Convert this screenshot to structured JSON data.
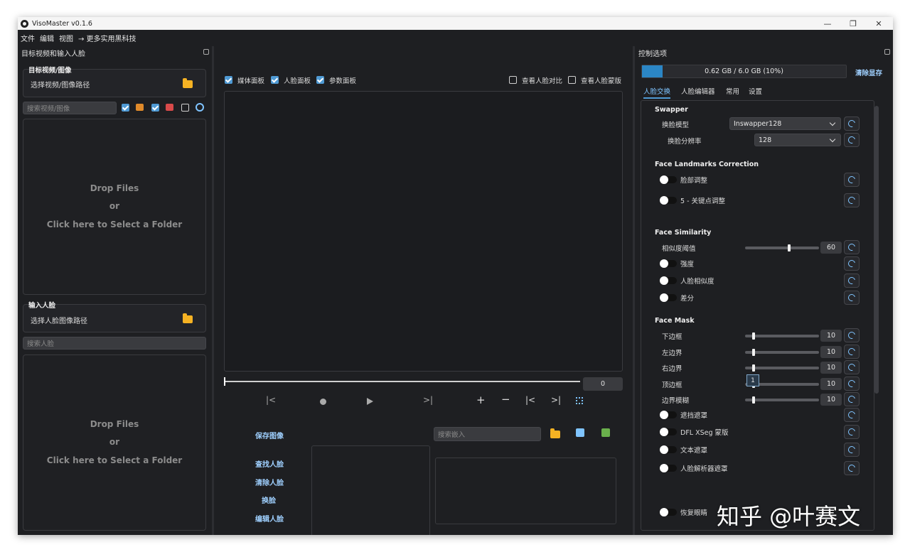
{
  "window": {
    "title": "VisoMaster v0.1.6"
  },
  "menu": [
    "文件",
    "编辑",
    "视图",
    "→ 更多实用黑科技"
  ],
  "left": {
    "dock_title": "目标视频和输入人脸",
    "target_group_title": "目标视频/图像",
    "target_path_label": "选择视频/图像路径",
    "search_media_placeholder": "搜索视频/图像",
    "drop": [
      "Drop Files",
      "or",
      "Click here to Select a Folder"
    ],
    "input_group_title": "输入人脸",
    "input_path_label": "选择人脸图像路径",
    "search_face_placeholder": "搜索人脸",
    "filters": [
      {
        "checked": true
      },
      {
        "checked": true
      },
      {
        "checked": false
      }
    ]
  },
  "center": {
    "checks": [
      {
        "label": "媒体面板",
        "checked": true
      },
      {
        "label": "人脸面板",
        "checked": true
      },
      {
        "label": "参数面板",
        "checked": true
      },
      {
        "label": "查看人脸对比",
        "checked": false
      },
      {
        "label": "查看人脸蒙版",
        "checked": false
      }
    ],
    "frame_value": "0",
    "save_image": "保存图像",
    "search_embed_placeholder": "搜索嵌入",
    "actions": [
      "查找人脸",
      "清除人脸",
      "换脸",
      "编辑人脸"
    ]
  },
  "right": {
    "dock_title": "控制选项",
    "vram_text": "0.62 GB / 6.0 GB (10%)",
    "vram_fraction": 0.1,
    "clear_vram": "清除显存",
    "tabs": [
      "人脸交换",
      "人脸编辑器",
      "常用",
      "设置"
    ],
    "sections": {
      "swapper": "Swapper",
      "landmarks": "Face Landmarks Correction",
      "similarity": "Face Similarity",
      "mask": "Face Mask"
    },
    "swap_model_label": "换脸模型",
    "swap_model_value": "Inswapper128",
    "swap_res_label": "换脸分辨率",
    "swap_res_value": "128",
    "landmark_toggles": [
      "脸部调整",
      "5 - 关键点调整"
    ],
    "sim_threshold_label": "相似度阈值",
    "sim_threshold_value": "60",
    "sim_toggles": [
      "强度",
      "人脸相似度",
      "差分"
    ],
    "mask_sliders": [
      {
        "label": "下边框",
        "value": "10"
      },
      {
        "label": "左边界",
        "value": "10"
      },
      {
        "label": "右边界",
        "value": "10"
      },
      {
        "label": "顶边框",
        "value": "10"
      },
      {
        "label": "边界模糊",
        "value": "10"
      }
    ],
    "tooltip_value": "1",
    "mask_toggles": [
      "遮挡遮罩",
      "DFL XSeg 蒙版",
      "文本遮罩",
      "人脸解析器遮罩"
    ],
    "restore_eyes": "恢复眼睛"
  },
  "watermark": "知乎 @叶赛文"
}
